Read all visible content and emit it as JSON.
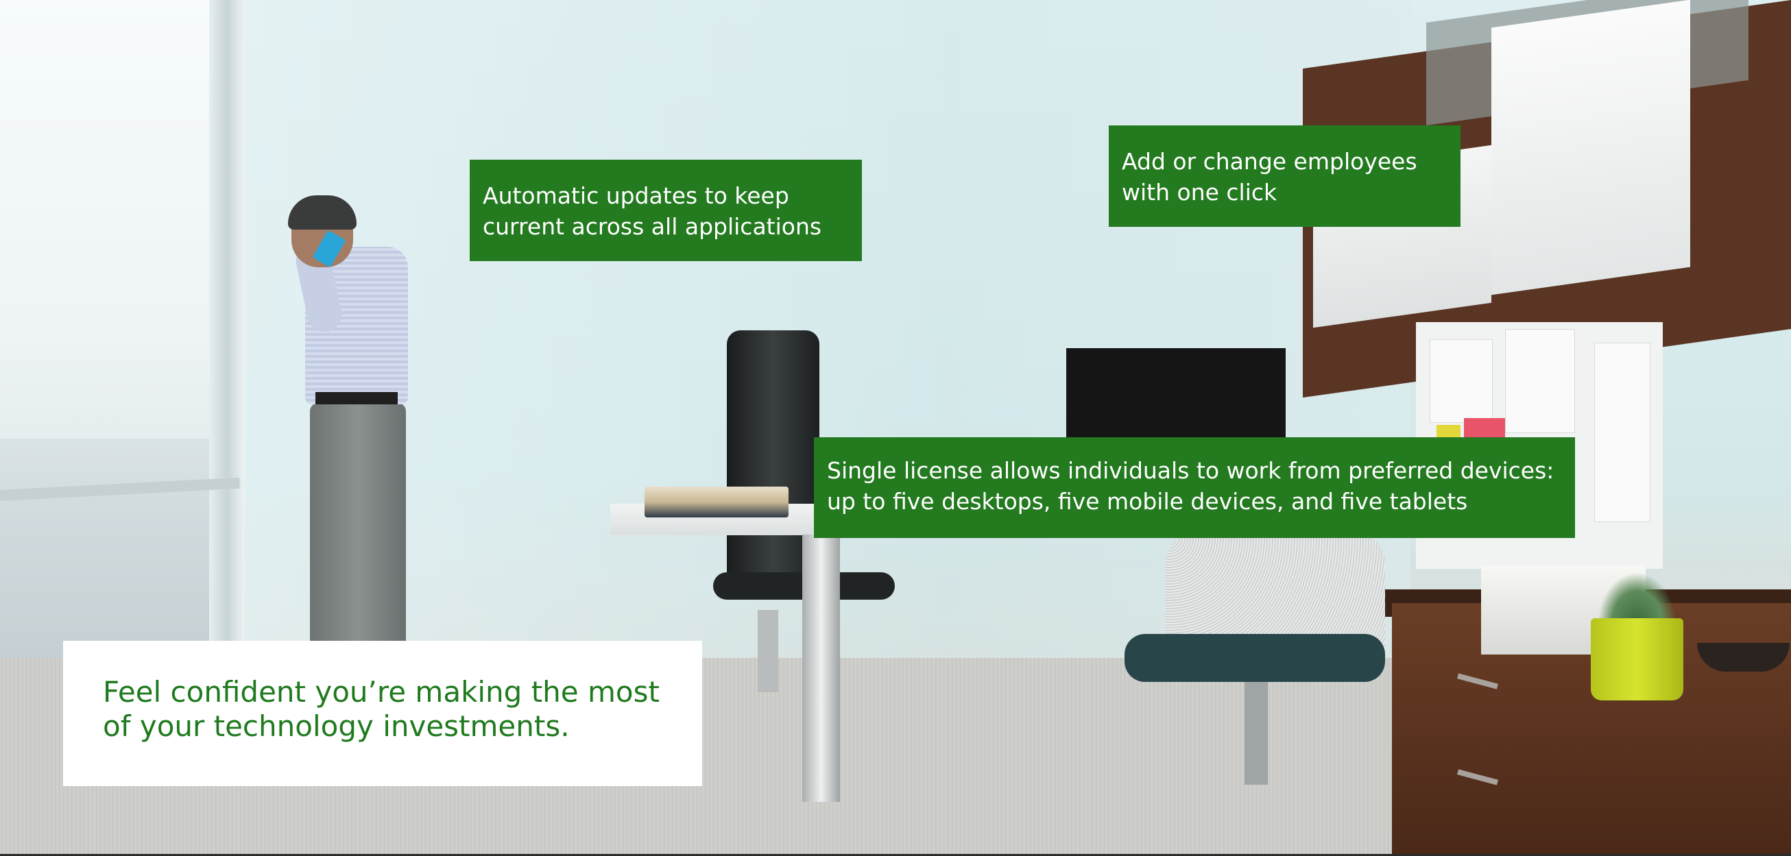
{
  "callouts": {
    "updates": "Automatic updates to keep\ncurrent across all applications",
    "employees": "Add or change employees\nwith one click",
    "license": "Single license allows individuals to work from preferred devices:\nup to five desktops, five mobile devices, and five tablets"
  },
  "headline": "Feel confident you’re making the most\nof your technology investments.",
  "colors": {
    "callout_green": "#237a1f",
    "headline_green": "#1f7a1e",
    "card_background": "#ffffff"
  }
}
